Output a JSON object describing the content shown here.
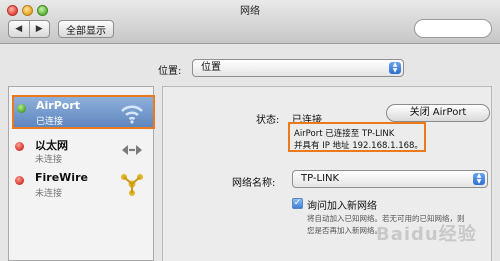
{
  "window": {
    "title": "网络"
  },
  "toolbar": {
    "back_icon": "chevron-left-icon",
    "forward_icon": "chevron-right-icon",
    "show_all_label": "全部显示"
  },
  "location": {
    "label": "位置:",
    "value": "位置"
  },
  "services": [
    {
      "name": "AirPort",
      "status": "已连接",
      "status_color": "#3f9d1f",
      "icon": "wifi-icon",
      "selected": true
    },
    {
      "name": "以太网",
      "status": "未连接",
      "status_color": "#cf2a20",
      "icon": "ethernet-icon",
      "selected": false
    },
    {
      "name": "FireWire",
      "status": "未连接",
      "status_color": "#cf2a20",
      "icon": "firewire-icon",
      "selected": false
    }
  ],
  "detail": {
    "status_label": "状态:",
    "status_value": "已连接",
    "toggle_button": "关闭 AirPort",
    "info_line1": "AirPort 已连接至 TP-LINK",
    "info_line2": "并具有 IP 地址 192.168.1.168。",
    "network_name_label": "网络名称:",
    "network_name_value": "TP-LINK",
    "ask_join_label": "询问加入新网络",
    "ask_join_checked": true,
    "help_line1": "将自动加入已知网络。若无可用的已知网络，则",
    "help_line2": "您是否再加入新网络。"
  },
  "accent_color": "#ec7a1c",
  "watermark": "Baidu经验"
}
